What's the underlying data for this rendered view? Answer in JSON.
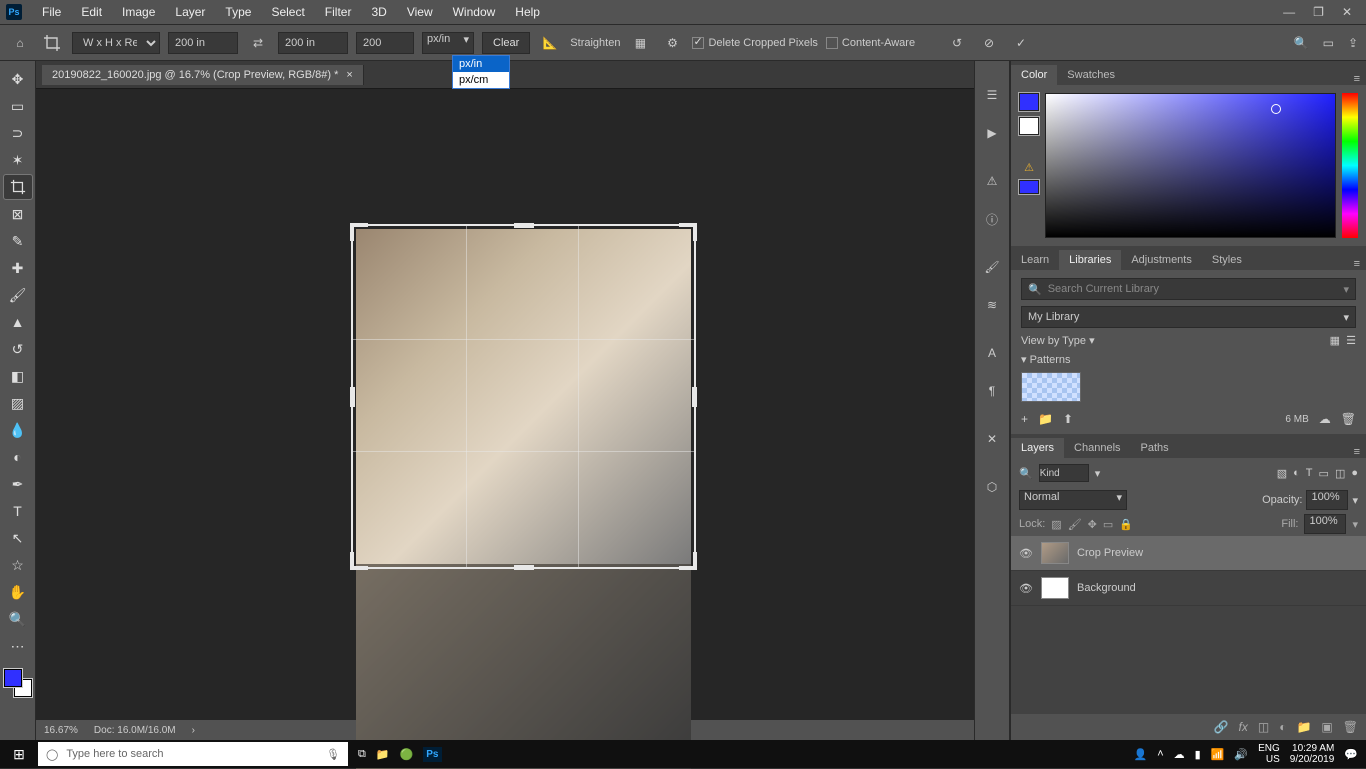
{
  "menubar": [
    "File",
    "Edit",
    "Image",
    "Layer",
    "Type",
    "Select",
    "Filter",
    "3D",
    "View",
    "Window",
    "Help"
  ],
  "options": {
    "preset": "W x H x Reso…",
    "width": "200 in",
    "height": "200 in",
    "resolution": "200",
    "unit": "px/in",
    "unit_options": [
      "px/in",
      "px/cm"
    ],
    "clear": "Clear",
    "straighten": "Straighten",
    "delete_cropped": "Delete Cropped Pixels",
    "content_aware": "Content-Aware"
  },
  "doc": {
    "tab": "20190822_160020.jpg @ 16.7% (Crop Preview, RGB/8#) *"
  },
  "status": {
    "zoom": "16.67%",
    "docsize": "Doc: 16.0M/16.0M"
  },
  "color_panel": {
    "tabs": [
      "Color",
      "Swatches"
    ],
    "fg": "#3030ff",
    "bg": "#3030ff",
    "picker_x": 0.78,
    "picker_y": 0.08
  },
  "lib_panel": {
    "tabs": [
      "Learn",
      "Libraries",
      "Adjustments",
      "Styles"
    ],
    "search_placeholder": "Search Current Library",
    "library": "My Library",
    "view": "View by Type",
    "section": "Patterns",
    "storage": "6 MB"
  },
  "layers_panel": {
    "tabs": [
      "Layers",
      "Channels",
      "Paths"
    ],
    "kind": "Kind",
    "blend": "Normal",
    "opacity_label": "Opacity:",
    "opacity": "100%",
    "lock_label": "Lock:",
    "fill_label": "Fill:",
    "fill": "100%",
    "layers": [
      {
        "name": "Crop Preview",
        "selected": true
      },
      {
        "name": "Background",
        "selected": false
      }
    ]
  },
  "taskbar": {
    "search": "Type here to search",
    "lang1": "ENG",
    "lang2": "US",
    "time": "10:29 AM",
    "date": "9/20/2019"
  }
}
